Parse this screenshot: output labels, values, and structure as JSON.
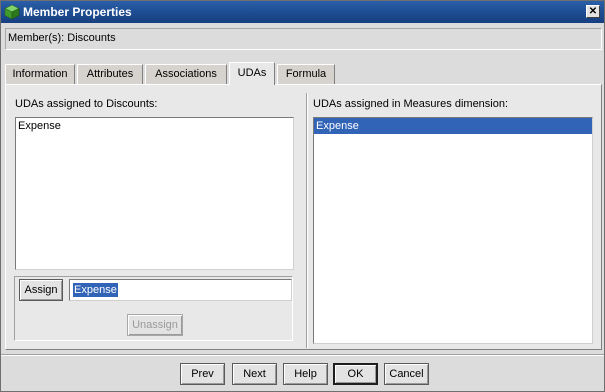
{
  "window": {
    "title": "Member Properties",
    "close_label": "✕",
    "icon": "cube-icon"
  },
  "member": {
    "label": "Member(s): Discounts"
  },
  "tabs": [
    {
      "label": "Information",
      "active": false
    },
    {
      "label": "Attributes",
      "active": false
    },
    {
      "label": "Associations",
      "active": false
    },
    {
      "label": "UDAs",
      "active": true
    },
    {
      "label": "Formula",
      "active": false
    }
  ],
  "left_panel": {
    "label": "UDAs assigned to Discounts:",
    "items": [
      "Expense"
    ]
  },
  "right_panel": {
    "label": "UDAs assigned in Measures dimension:",
    "items": [
      "Expense"
    ],
    "selected_index": 0
  },
  "assign": {
    "button_label": "Assign",
    "input_value": "Expense",
    "unassign_label": "Unassign"
  },
  "footer": {
    "prev": "Prev",
    "next": "Next",
    "help": "Help",
    "ok": "OK",
    "cancel": "Cancel"
  },
  "colors": {
    "title_bar": "#1f4f95",
    "selection": "#3163b6"
  }
}
